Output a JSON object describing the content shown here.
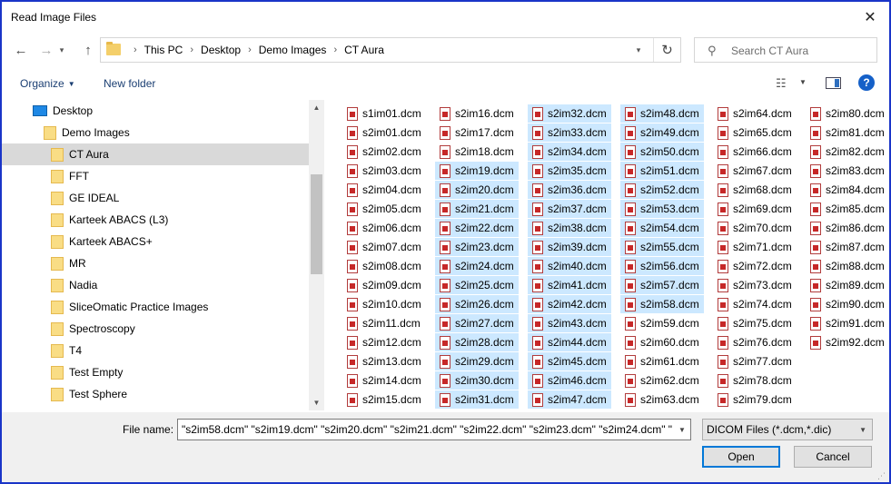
{
  "window": {
    "title": "Read Image Files",
    "close_glyph": "✕"
  },
  "nav": {
    "back": "←",
    "forward": "→",
    "history": "▾",
    "up": "↑",
    "breadcrumbs": [
      "This PC",
      "Desktop",
      "Demo Images",
      "CT Aura"
    ],
    "separator": "›",
    "address_dropdown": "▾",
    "refresh": "↻",
    "search_placeholder": "Search CT Aura"
  },
  "toolbar": {
    "organize_label": "Organize",
    "new_folder_label": "New folder",
    "help_label": "?"
  },
  "tree": [
    {
      "label": "Desktop",
      "indent": 1,
      "icon": "desktop-icon",
      "selected": false
    },
    {
      "label": "Demo Images",
      "indent": 2,
      "icon": "folder-icon",
      "selected": false
    },
    {
      "label": "CT Aura",
      "indent": 3,
      "icon": "folder-icon",
      "selected": true
    },
    {
      "label": "FFT",
      "indent": 3,
      "icon": "folder-icon",
      "selected": false
    },
    {
      "label": "GE IDEAL",
      "indent": 3,
      "icon": "folder-icon",
      "selected": false
    },
    {
      "label": "Karteek ABACS (L3)",
      "indent": 3,
      "icon": "folder-icon",
      "selected": false
    },
    {
      "label": "Karteek ABACS+",
      "indent": 3,
      "icon": "folder-icon",
      "selected": false
    },
    {
      "label": "MR",
      "indent": 3,
      "icon": "folder-icon",
      "selected": false
    },
    {
      "label": "Nadia",
      "indent": 3,
      "icon": "folder-icon",
      "selected": false
    },
    {
      "label": "SliceOmatic Practice Images",
      "indent": 3,
      "icon": "folder-icon",
      "selected": false
    },
    {
      "label": "Spectroscopy",
      "indent": 3,
      "icon": "folder-icon",
      "selected": false
    },
    {
      "label": "T4",
      "indent": 3,
      "icon": "folder-icon",
      "selected": false
    },
    {
      "label": "Test Empty",
      "indent": 3,
      "icon": "folder-icon",
      "selected": false
    },
    {
      "label": "Test Sphere",
      "indent": 3,
      "icon": "folder-icon",
      "selected": false
    }
  ],
  "files": {
    "columns": [
      [
        "s1im01.dcm",
        "s2im01.dcm",
        "s2im02.dcm",
        "s2im03.dcm",
        "s2im04.dcm",
        "s2im05.dcm",
        "s2im06.dcm",
        "s2im07.dcm",
        "s2im08.dcm",
        "s2im09.dcm",
        "s2im10.dcm",
        "s2im11.dcm",
        "s2im12.dcm",
        "s2im13.dcm",
        "s2im14.dcm",
        "s2im15.dcm"
      ],
      [
        "s2im16.dcm",
        "s2im17.dcm",
        "s2im18.dcm",
        "s2im19.dcm",
        "s2im20.dcm",
        "s2im21.dcm",
        "s2im22.dcm",
        "s2im23.dcm",
        "s2im24.dcm",
        "s2im25.dcm",
        "s2im26.dcm",
        "s2im27.dcm",
        "s2im28.dcm",
        "s2im29.dcm",
        "s2im30.dcm",
        "s2im31.dcm"
      ],
      [
        "s2im32.dcm",
        "s2im33.dcm",
        "s2im34.dcm",
        "s2im35.dcm",
        "s2im36.dcm",
        "s2im37.dcm",
        "s2im38.dcm",
        "s2im39.dcm",
        "s2im40.dcm",
        "s2im41.dcm",
        "s2im42.dcm",
        "s2im43.dcm",
        "s2im44.dcm",
        "s2im45.dcm",
        "s2im46.dcm",
        "s2im47.dcm"
      ],
      [
        "s2im48.dcm",
        "s2im49.dcm",
        "s2im50.dcm",
        "s2im51.dcm",
        "s2im52.dcm",
        "s2im53.dcm",
        "s2im54.dcm",
        "s2im55.dcm",
        "s2im56.dcm",
        "s2im57.dcm",
        "s2im58.dcm",
        "s2im59.dcm",
        "s2im60.dcm",
        "s2im61.dcm",
        "s2im62.dcm",
        "s2im63.dcm"
      ],
      [
        "s2im64.dcm",
        "s2im65.dcm",
        "s2im66.dcm",
        "s2im67.dcm",
        "s2im68.dcm",
        "s2im69.dcm",
        "s2im70.dcm",
        "s2im71.dcm",
        "s2im72.dcm",
        "s2im73.dcm",
        "s2im74.dcm",
        "s2im75.dcm",
        "s2im76.dcm",
        "s2im77.dcm",
        "s2im78.dcm",
        "s2im79.dcm"
      ],
      [
        "s2im80.dcm",
        "s2im81.dcm",
        "s2im82.dcm",
        "s2im83.dcm",
        "s2im84.dcm",
        "s2im85.dcm",
        "s2im86.dcm",
        "s2im87.dcm",
        "s2im88.dcm",
        "s2im89.dcm",
        "s2im90.dcm",
        "s2im91.dcm",
        "s2im92.dcm"
      ]
    ],
    "selected": [
      "s2im19.dcm",
      "s2im20.dcm",
      "s2im21.dcm",
      "s2im22.dcm",
      "s2im23.dcm",
      "s2im24.dcm",
      "s2im25.dcm",
      "s2im26.dcm",
      "s2im27.dcm",
      "s2im28.dcm",
      "s2im29.dcm",
      "s2im30.dcm",
      "s2im31.dcm",
      "s2im32.dcm",
      "s2im33.dcm",
      "s2im34.dcm",
      "s2im35.dcm",
      "s2im36.dcm",
      "s2im37.dcm",
      "s2im38.dcm",
      "s2im39.dcm",
      "s2im40.dcm",
      "s2im41.dcm",
      "s2im42.dcm",
      "s2im43.dcm",
      "s2im44.dcm",
      "s2im45.dcm",
      "s2im46.dcm",
      "s2im47.dcm",
      "s2im48.dcm",
      "s2im49.dcm",
      "s2im50.dcm",
      "s2im51.dcm",
      "s2im52.dcm",
      "s2im53.dcm",
      "s2im54.dcm",
      "s2im55.dcm",
      "s2im56.dcm",
      "s2im57.dcm",
      "s2im58.dcm"
    ],
    "icon": "pdf-file-icon"
  },
  "bottom": {
    "file_name_label": "File name:",
    "file_name_value": "\"s2im58.dcm\" \"s2im19.dcm\" \"s2im20.dcm\" \"s2im21.dcm\" \"s2im22.dcm\" \"s2im23.dcm\" \"s2im24.dcm\" \"",
    "file_type_value": "DICOM Files (*.dcm,*.dic)",
    "open_label": "Open",
    "cancel_label": "Cancel"
  },
  "colors": {
    "selection": "#cce8ff",
    "window_border": "#1a35c8",
    "link": "#1a3e72",
    "tree_selection": "#d9d9d9"
  }
}
